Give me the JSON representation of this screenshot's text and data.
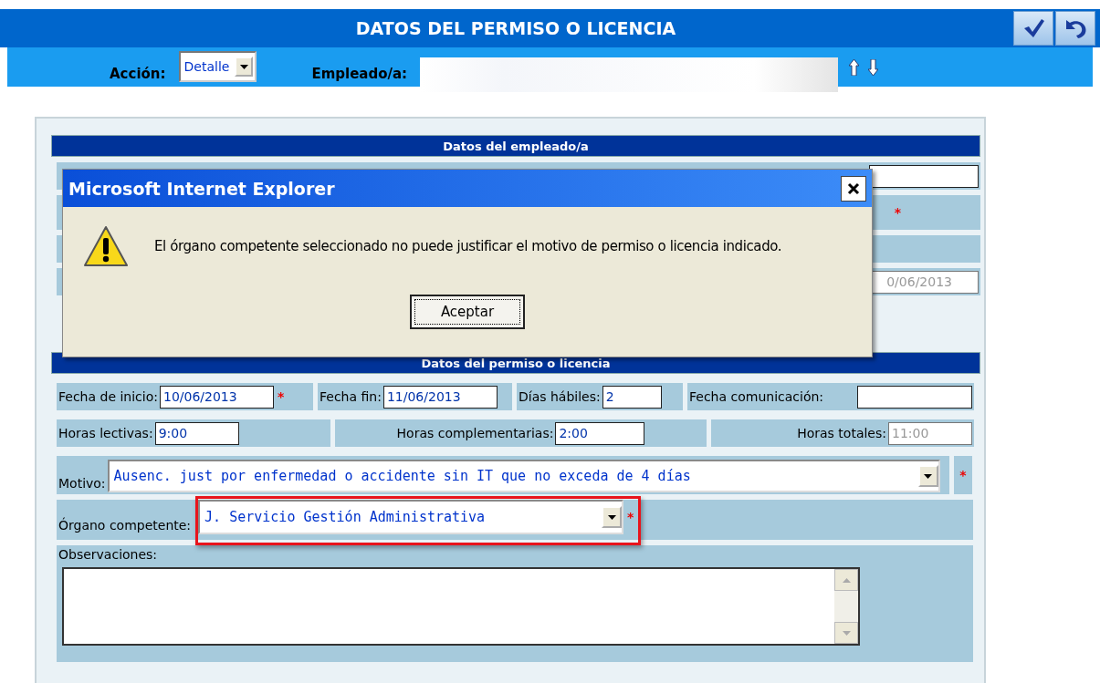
{
  "header": {
    "title": "DATOS DEL PERMISO O LICENCIA"
  },
  "toolbar": {
    "accion_label": "Acción:",
    "accion_value": "Detalle",
    "empleado_label": "Empleado/a:"
  },
  "employee_section": {
    "title": "Datos del empleado/a",
    "visible_date": "0/06/2013",
    "mark": "*"
  },
  "permit_section": {
    "title": "Datos del permiso o licencia",
    "row1": [
      {
        "label": "Fecha de inicio:",
        "value": "10/06/2013",
        "mark": "*"
      },
      {
        "label": "Fecha fin:",
        "value": "11/06/2013"
      },
      {
        "label": "Días hábiles:",
        "value": "2"
      },
      {
        "label": "Fecha comunicación:"
      }
    ],
    "row2": [
      {
        "label": "Horas lectivas:",
        "value": "9:00",
        "disabled": false
      },
      {
        "label": "Horas complementarias:",
        "value": "2:00",
        "disabled": false
      },
      {
        "label": "Horas totales:",
        "value": "11:00",
        "disabled": true
      }
    ],
    "motivo": {
      "label": "Motivo:",
      "value": "Ausenc. just por enfermedad o accidente sin IT que no exceda de 4 días",
      "mark": "*"
    },
    "organo": {
      "label": "Órgano competente:",
      "value": "J. Servicio Gestión Administrativa",
      "mark": "*",
      "highlighted": true
    },
    "observaciones": {
      "label": "Observaciones:"
    }
  },
  "dialog": {
    "title": "Microsoft Internet Explorer",
    "message": "El órgano competente seleccionado no puede justificar el motivo de permiso o licencia indicado.",
    "button": "Aceptar"
  }
}
